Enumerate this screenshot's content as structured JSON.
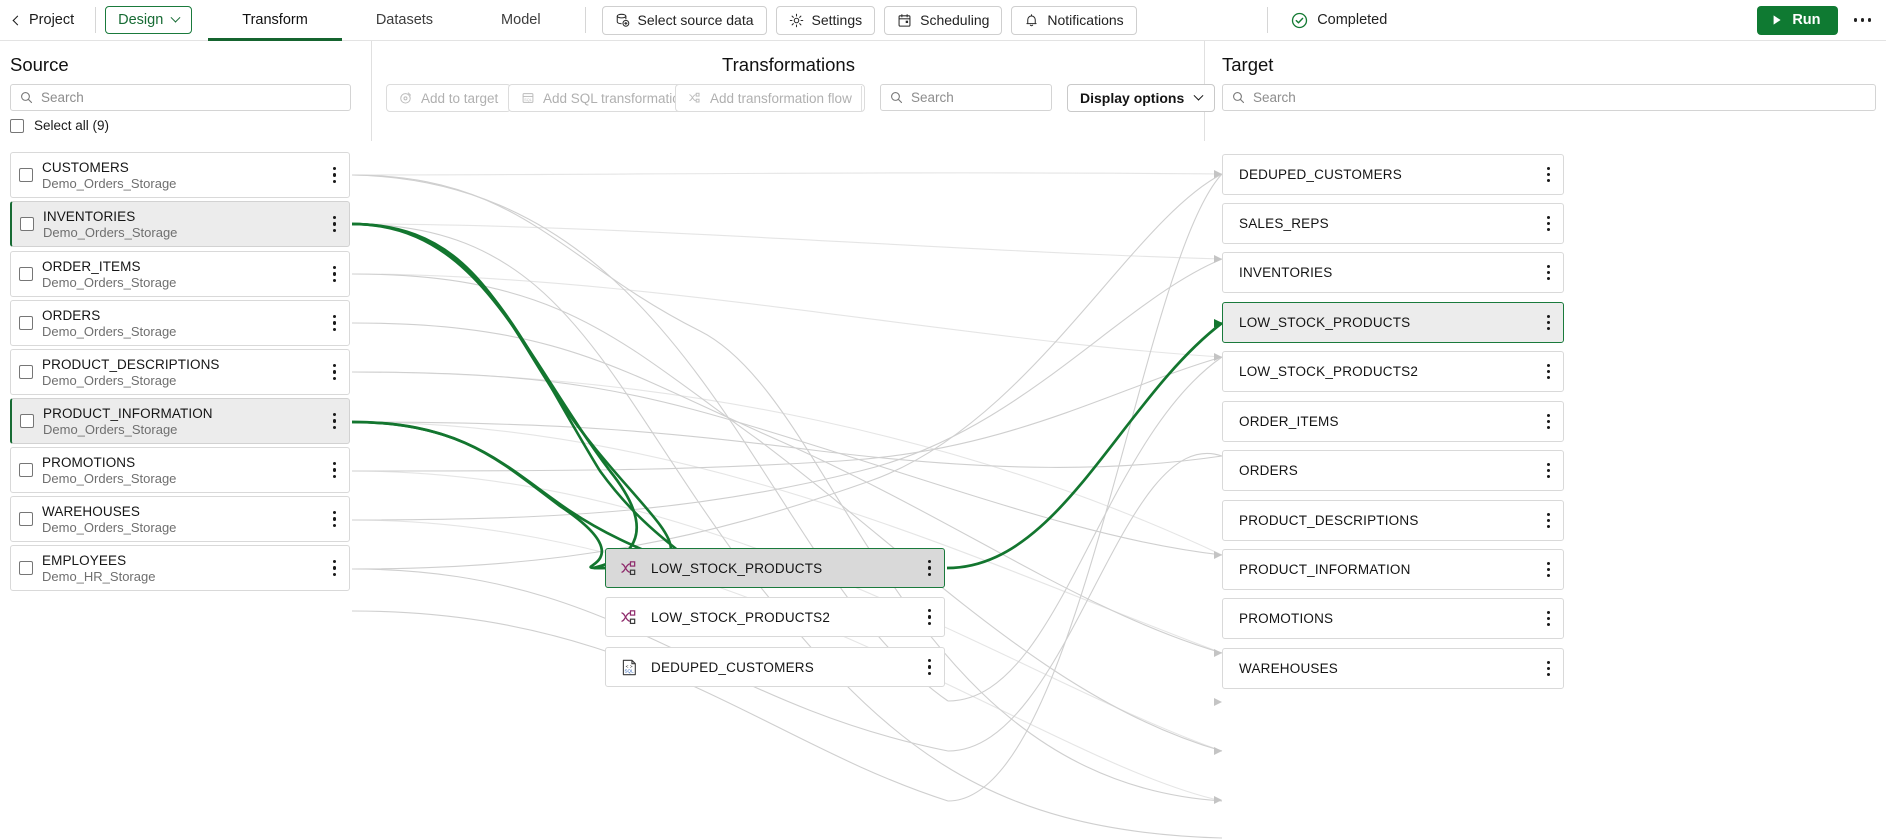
{
  "topbar": {
    "back_label": "Project",
    "mode_label": "Design",
    "tabs": [
      {
        "label": "Transform",
        "active": true
      },
      {
        "label": "Datasets",
        "active": false
      },
      {
        "label": "Model",
        "active": false
      }
    ],
    "buttons": [
      {
        "label": "Select source data",
        "icon": "database-add-icon"
      },
      {
        "label": "Settings",
        "icon": "gear-icon"
      },
      {
        "label": "Scheduling",
        "icon": "calendar-icon"
      },
      {
        "label": "Notifications",
        "icon": "bell-icon"
      }
    ],
    "status_label": "Completed",
    "status_icon": "check-circle-icon",
    "run_label": "Run",
    "overflow_icon": "kebab-horizontal-icon",
    "accent_green": "#0f7a32",
    "status_green": "#176b34"
  },
  "source": {
    "title": "Source",
    "search_placeholder": "Search",
    "select_all_label": "Select all (9)",
    "items": [
      {
        "name": "CUSTOMERS",
        "storage": "Demo_Orders_Storage",
        "selected": false
      },
      {
        "name": "INVENTORIES",
        "storage": "Demo_Orders_Storage",
        "selected": true
      },
      {
        "name": "ORDER_ITEMS",
        "storage": "Demo_Orders_Storage",
        "selected": false
      },
      {
        "name": "ORDERS",
        "storage": "Demo_Orders_Storage",
        "selected": false
      },
      {
        "name": "PRODUCT_DESCRIPTIONS",
        "storage": "Demo_Orders_Storage",
        "selected": false
      },
      {
        "name": "PRODUCT_INFORMATION",
        "storage": "Demo_Orders_Storage",
        "selected": true
      },
      {
        "name": "PROMOTIONS",
        "storage": "Demo_Orders_Storage",
        "selected": false
      },
      {
        "name": "WAREHOUSES",
        "storage": "Demo_Orders_Storage",
        "selected": false
      },
      {
        "name": "EMPLOYEES",
        "storage": "Demo_HR_Storage",
        "selected": false
      }
    ]
  },
  "transformations": {
    "title": "Transformations",
    "search_placeholder": "Search",
    "display_options_label": "Display options",
    "toolbar": [
      {
        "label": "Add to target",
        "icon": "target-icon",
        "disabled": true
      },
      {
        "label": "Add SQL transformation",
        "icon": "sql-icon",
        "disabled": true
      },
      {
        "label": "Add transformation flow",
        "icon": "flow-icon",
        "disabled": true
      }
    ],
    "items": [
      {
        "name": "LOW_STOCK_PRODUCTS",
        "icon": "flow-icon",
        "selected": true
      },
      {
        "name": "LOW_STOCK_PRODUCTS2",
        "icon": "flow-icon",
        "selected": false
      },
      {
        "name": "DEDUPED_CUSTOMERS",
        "icon": "sql-icon",
        "selected": false
      }
    ]
  },
  "target": {
    "title": "Target",
    "search_placeholder": "Search",
    "items": [
      {
        "name": "DEDUPED_CUSTOMERS",
        "selected": false
      },
      {
        "name": "SALES_REPS",
        "selected": false
      },
      {
        "name": "INVENTORIES",
        "selected": false
      },
      {
        "name": "LOW_STOCK_PRODUCTS",
        "selected": true
      },
      {
        "name": "LOW_STOCK_PRODUCTS2",
        "selected": false
      },
      {
        "name": "ORDER_ITEMS",
        "selected": false
      },
      {
        "name": "ORDERS",
        "selected": false
      },
      {
        "name": "PRODUCT_DESCRIPTIONS",
        "selected": false
      },
      {
        "name": "PRODUCT_INFORMATION",
        "selected": false
      },
      {
        "name": "PROMOTIONS",
        "selected": false
      },
      {
        "name": "WAREHOUSES",
        "selected": false
      }
    ]
  }
}
